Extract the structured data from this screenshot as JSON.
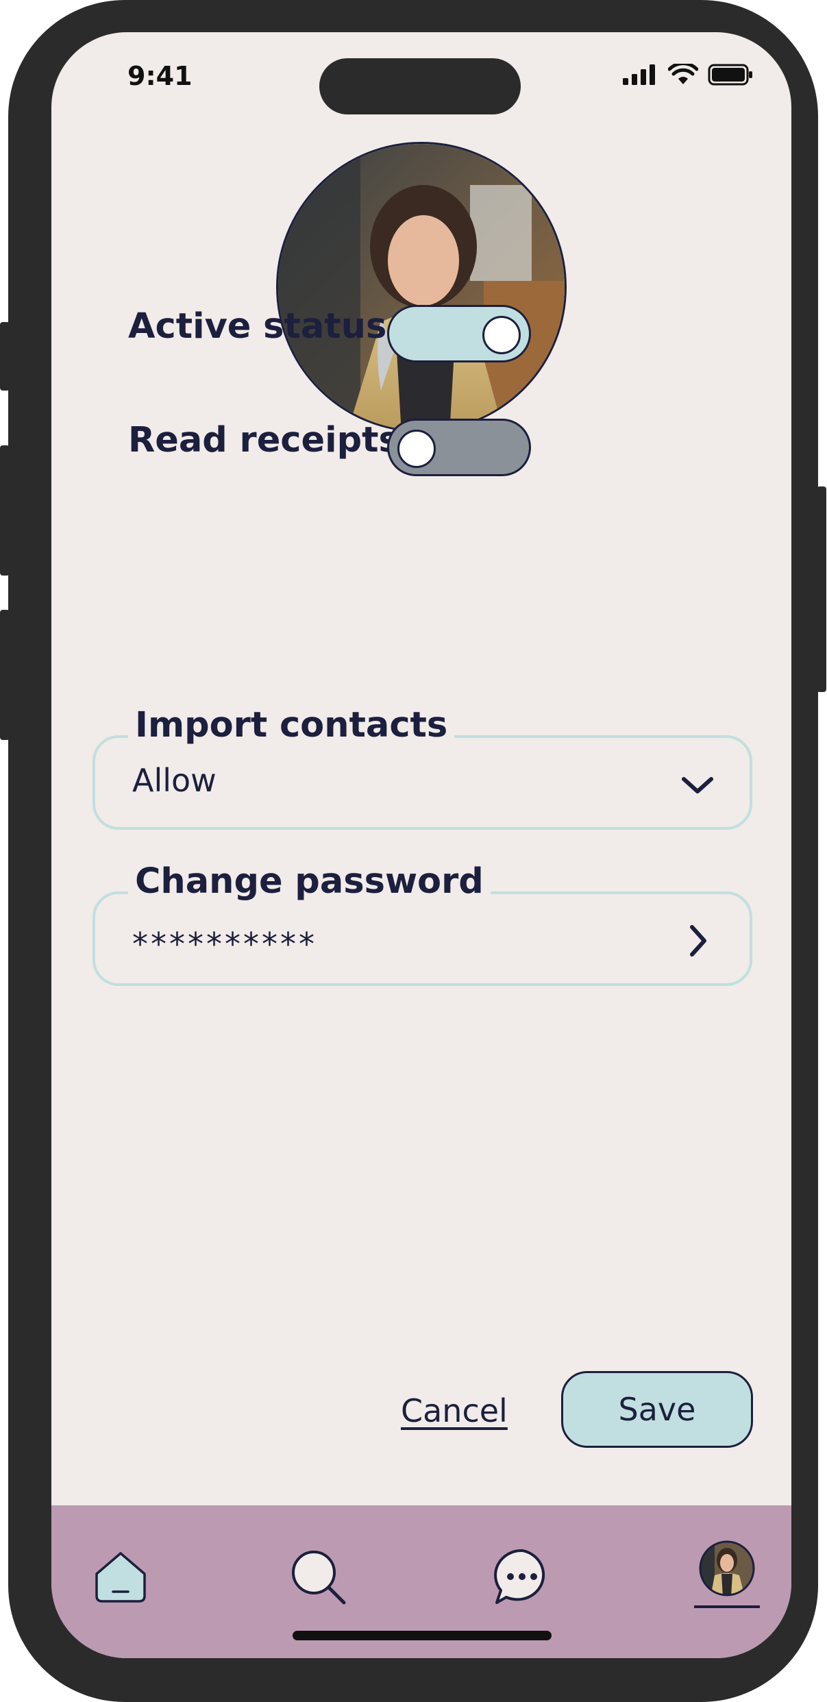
{
  "status_bar": {
    "time": "9:41"
  },
  "profile": {
    "avatar": "profile-photo"
  },
  "settings": {
    "active_status": {
      "label": "Active status",
      "on": true
    },
    "read_receipts": {
      "label": "Read receipts",
      "on": false
    },
    "import_contacts": {
      "label": "Import contacts",
      "value": "Allow",
      "icon": "chevron-down-icon"
    },
    "change_password": {
      "label": "Change password",
      "value": "**********",
      "icon": "chevron-right-icon"
    }
  },
  "actions": {
    "cancel_label": "Cancel",
    "save_label": "Save"
  },
  "nav": {
    "items": [
      "home-icon",
      "search-icon",
      "chat-icon",
      "profile-avatar"
    ],
    "active": "profile-avatar"
  },
  "colors": {
    "background": "#f1ece9",
    "accent": "#c1dfe0",
    "navbar": "#bc9bb2",
    "toggle_off": "#8a9198",
    "text": "#1c1f3d"
  }
}
